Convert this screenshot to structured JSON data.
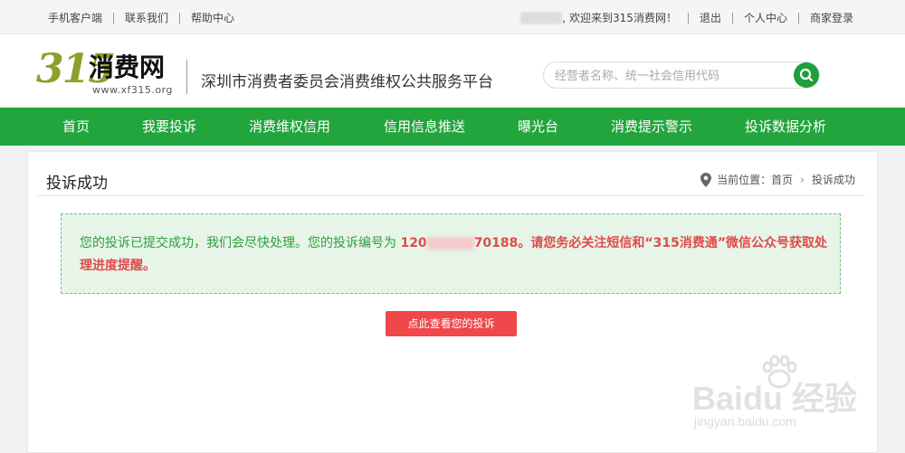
{
  "topbar": {
    "links_left": [
      "手机客户端",
      "联系我们",
      "帮助中心"
    ],
    "welcome": ", 欢迎来到315消费网！",
    "links_right": [
      "退出",
      "个人中心",
      "商家登录"
    ]
  },
  "header": {
    "logo_number": "315",
    "logo_text": "消费网",
    "logo_url": "www.xf315.org",
    "platform_name": "深圳市消费者委员会消费维权公共服务平台",
    "search_placeholder": "经营者名称、统一社会信用代码"
  },
  "nav": {
    "items": [
      "首页",
      "我要投诉",
      "消费维权信用",
      "信用信息推送",
      "曝光台",
      "消费提示警示",
      "投诉数据分析"
    ]
  },
  "content": {
    "page_title": "投诉成功",
    "breadcrumb_label": "当前位置：",
    "breadcrumb_home": "首页",
    "breadcrumb_current": "投诉成功",
    "notice_text": "您的投诉已提交成功，我们会尽快处理。您的投诉编号为",
    "complaint_number_prefix": "120",
    "complaint_number_suffix": "70188",
    "notice_warning": "。请您务必关注短信和“315消费通”微信公众号获取处理进度提醒。",
    "view_button": "点此查看您的投诉"
  },
  "watermark": {
    "text": "Baidu 经验",
    "url": "jingyan.baidu.com"
  },
  "colors": {
    "nav_green": "#22a53c",
    "notice_bg": "#e6f5e8",
    "notice_text": "#2f9e3f",
    "warning_red": "#e14a4a",
    "button_red": "#f0474b"
  }
}
